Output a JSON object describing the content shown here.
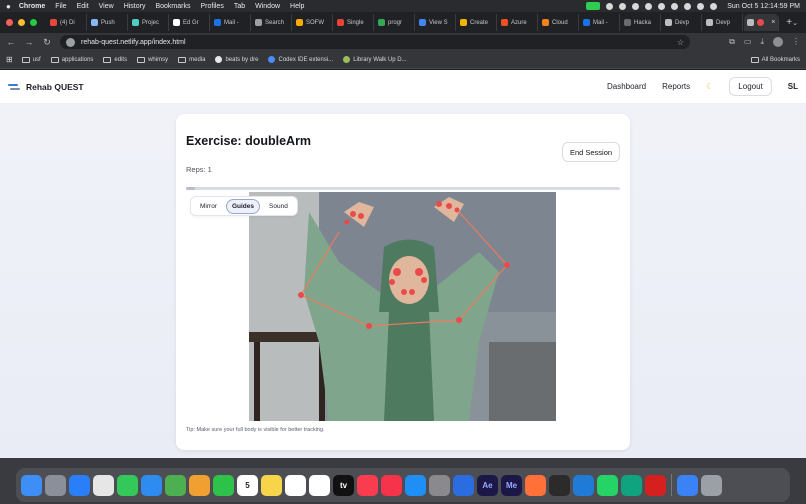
{
  "menubar": {
    "app": "Chrome",
    "items": [
      "File",
      "Edit",
      "View",
      "History",
      "Bookmarks",
      "Profiles",
      "Tab",
      "Window",
      "Help"
    ],
    "clock": "Sun Oct 5  12:14:59 PM"
  },
  "tabs": [
    {
      "label": "(4) Di",
      "color": "#e8453c"
    },
    {
      "label": "Push",
      "color": "#8ab4f8"
    },
    {
      "label": "Projec",
      "color": "#4ecdc4"
    },
    {
      "label": "Ed Gr",
      "color": "#ffffff"
    },
    {
      "label": "Mail -",
      "color": "#1a73e8"
    },
    {
      "label": "Search",
      "color": "#9aa0a6"
    },
    {
      "label": "SOFW",
      "color": "#f9ab00"
    },
    {
      "label": "Single",
      "color": "#ea4335"
    },
    {
      "label": "progr",
      "color": "#34a853"
    },
    {
      "label": "View S",
      "color": "#4285f4"
    },
    {
      "label": "Create",
      "color": "#f4b400"
    },
    {
      "label": "Azure",
      "color": "#f25022"
    },
    {
      "label": "Cloud",
      "color": "#f48120"
    },
    {
      "label": "Mail -",
      "color": "#1a73e8"
    },
    {
      "label": "Hacka",
      "color": "#6b6b6b"
    },
    {
      "label": "Devp",
      "color": "#bdbdbd"
    },
    {
      "label": "Devp",
      "color": "#bdbdbd"
    }
  ],
  "active_tab": {
    "label": "",
    "close": "×"
  },
  "new_tab": "+",
  "url": "rehab-quest.netlify.app/index.html",
  "bookmarks": [
    {
      "label": "usf",
      "type": "folder"
    },
    {
      "label": "applications",
      "type": "folder"
    },
    {
      "label": "edits",
      "type": "folder"
    },
    {
      "label": "whimsy",
      "type": "folder"
    },
    {
      "label": "media",
      "type": "folder"
    },
    {
      "label": "beats by dre",
      "type": "site",
      "color": "#e8e8e8"
    },
    {
      "label": "Codex IDE extensi...",
      "type": "site",
      "color": "#4a8cff"
    },
    {
      "label": "Library Walk Up D...",
      "type": "site",
      "color": "#9bbf5a"
    }
  ],
  "all_bookmarks": "All Bookmarks",
  "app": {
    "name": "Rehab QUEST",
    "nav": {
      "dashboard": "Dashboard",
      "reports": "Reports",
      "theme_icon": "☾",
      "logout": "Logout",
      "user_initials": "SL"
    }
  },
  "session": {
    "title": "Exercise: doubleArm",
    "reps": "Reps: 1",
    "end_session": "End Session",
    "progress": 0.02,
    "controls": {
      "mirror": "Mirror",
      "guides": "Guides",
      "sound": "Sound",
      "active": "guides"
    },
    "tip": "Tip: Make sure your full body is visible for better tracking."
  },
  "colors": {
    "accent": "#3a7bd5",
    "landmark": "#e84b4b",
    "skeleton": "#f07a5a"
  },
  "dock": [
    "finder",
    "launchpad",
    "safari",
    "chrome",
    "messages",
    "mail",
    "maps",
    "photos",
    "facetime",
    "calendar",
    "notes",
    "reminders",
    "freeform",
    "tv",
    "music",
    "news",
    "appstore",
    "settings",
    "xcode",
    "aftereffects",
    "media-encoder",
    "firefox",
    "terminal",
    "vscode",
    "whatsapp",
    "chatgpt",
    "acrobat",
    "downloads",
    "trash"
  ],
  "calendar_day": "5",
  "dock_labels": {
    "aftereffects": "Ae",
    "media-encoder": "Me",
    "tv": "tv"
  }
}
